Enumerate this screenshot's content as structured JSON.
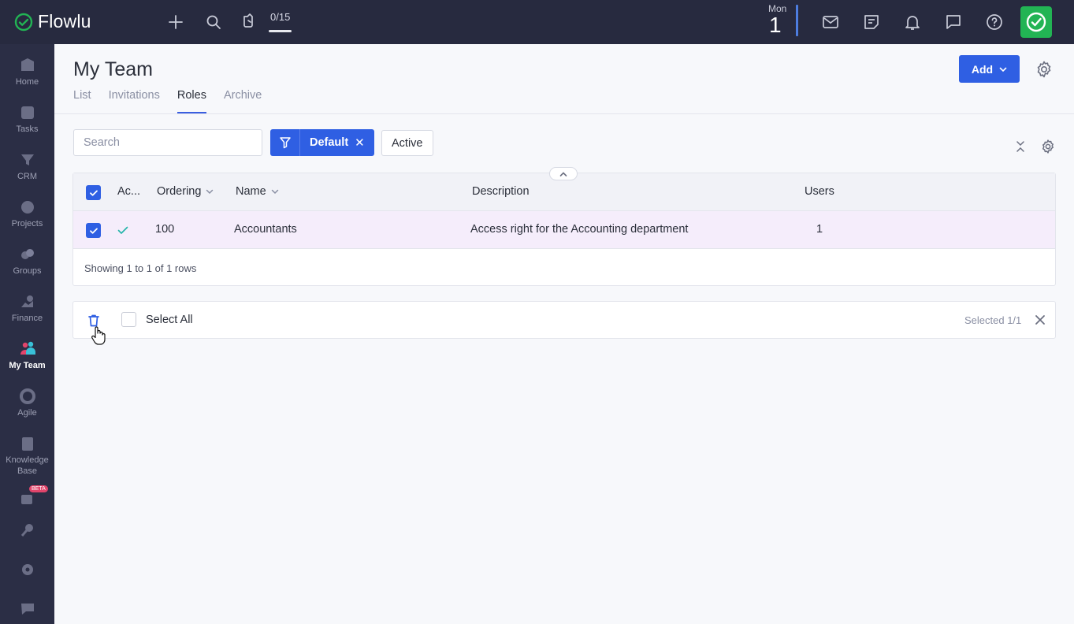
{
  "topbar": {
    "logo_text": "Flowlu",
    "counter": "0/15",
    "date_day": "Mon",
    "date_num": "1",
    "icons": [
      "plus-icon",
      "search-icon",
      "timer-icon",
      "mail-icon",
      "notes-icon",
      "bell-icon",
      "chat-icon",
      "help-icon",
      "check-icon"
    ]
  },
  "sidebar": {
    "items": [
      {
        "label": "Home",
        "icon": "home-icon"
      },
      {
        "label": "Tasks",
        "icon": "tasks-icon"
      },
      {
        "label": "CRM",
        "icon": "crm-icon"
      },
      {
        "label": "Projects",
        "icon": "projects-icon"
      },
      {
        "label": "Groups",
        "icon": "groups-icon"
      },
      {
        "label": "Finance",
        "icon": "finance-icon"
      },
      {
        "label": "My Team",
        "icon": "team-icon"
      },
      {
        "label": "Agile",
        "icon": "agile-icon"
      },
      {
        "label": "Knowledge Base",
        "icon": "knowledge-base-icon"
      },
      {
        "label": "",
        "icon": "beta-module-icon"
      },
      {
        "label": "",
        "icon": "key-icon"
      },
      {
        "label": "",
        "icon": "settings-icon"
      },
      {
        "label": "",
        "icon": "feedback-icon"
      }
    ],
    "beta_label": "BETA"
  },
  "page": {
    "title": "My Team",
    "tabs": [
      "List",
      "Invitations",
      "Roles",
      "Archive"
    ],
    "active_tab": "Roles",
    "add_label": "Add"
  },
  "filters": {
    "search_placeholder": "Search",
    "filter_chip": "Default",
    "status_chip": "Active"
  },
  "table": {
    "columns": [
      "Ac...",
      "Ordering",
      "Name",
      "Description",
      "Users"
    ],
    "rows": [
      {
        "active": true,
        "ordering": "100",
        "name": "Accountants",
        "description": "Access right for the Accounting department",
        "users": "1"
      }
    ],
    "footer": "Showing 1 to 1 of 1 rows"
  },
  "bulk": {
    "select_all": "Select All",
    "selected": "Selected 1/1"
  },
  "colors": {
    "topbar": "#272a3f",
    "sidebar": "#2b2e45",
    "accent": "#2f5fe3",
    "success": "#22b454",
    "row_highlight": "#f5edfb"
  }
}
